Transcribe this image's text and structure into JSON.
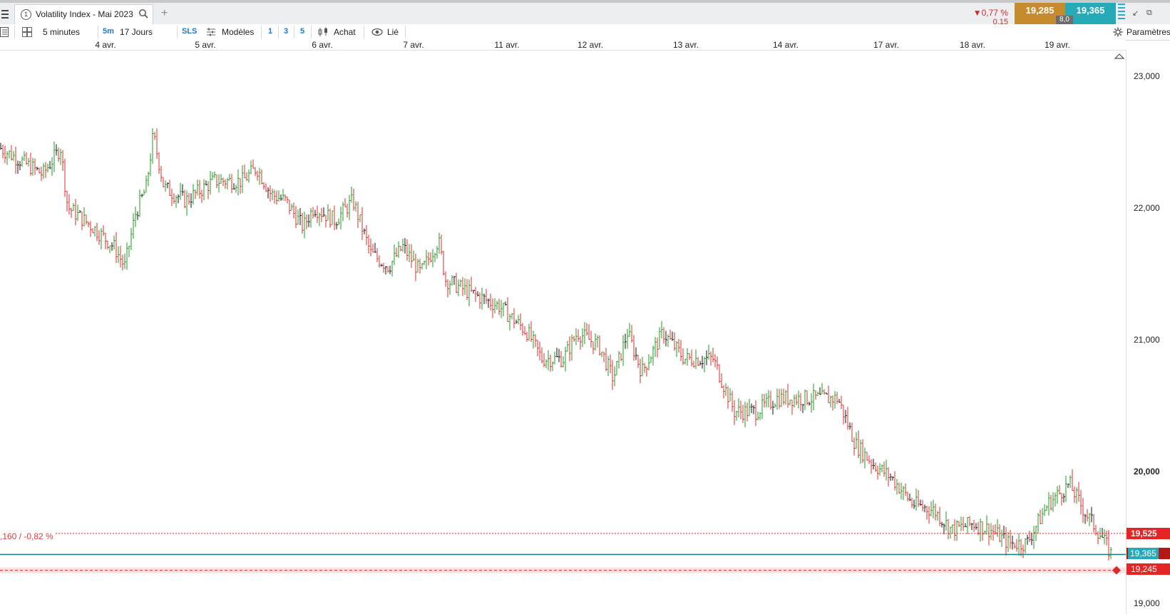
{
  "tab": {
    "number": "1",
    "title": "Volatility Index - Mai 2023",
    "add_label": "+"
  },
  "quote": {
    "change_pct": "▼0,77 %",
    "change_abs": "0,15",
    "bid": "19,285",
    "ask": "19,365",
    "spread": "8,0"
  },
  "toolbar": {
    "interval": "5 minutes",
    "interval_short": "5m",
    "range": "17 Jours",
    "sls": "SLS",
    "templates": "Modèles",
    "q1": "1",
    "q2": "3",
    "q3": "5",
    "buy": "Achat",
    "linked": "Lié",
    "settings": "Paramètres"
  },
  "date_axis": [
    "4 avr.",
    "5 avr.",
    "6 avr.",
    "7 avr.",
    "11 avr.",
    "12 avr.",
    "13 avr.",
    "14 avr.",
    "17 avr.",
    "18 avr.",
    "19 avr."
  ],
  "price_axis": [
    "23,000",
    "22,000",
    "21,000",
    "20,000",
    "19,000"
  ],
  "lines": {
    "reference_label": ",160 / -0,82 %",
    "reference_tag": "19,525",
    "current_tag": "19,365",
    "stop_tag": "19,245"
  },
  "colors": {
    "up": "#1f9a1f",
    "down": "#e02828",
    "neutral": "#111111",
    "reference": "#e02828",
    "current": "#1c7f8c",
    "stop_band": "#fde0e0",
    "bid_bg": "#c58b2c",
    "ask_bg": "#27aab7"
  },
  "chart_data": {
    "type": "line",
    "title": "",
    "x": [
      "4 avr.",
      "5 avr.",
      "6 avr.",
      "7 avr.",
      "11 avr.",
      "12 avr.",
      "13 avr.",
      "14 avr.",
      "17 avr.",
      "18 avr.",
      "19 avr."
    ],
    "ylim": [
      18.95,
      23.15
    ],
    "series": [
      {
        "values": [
          22.45,
          22.0,
          22.2,
          21.7,
          21.85,
          20.95,
          20.9,
          20.55,
          20.55,
          19.35,
          19.45
        ]
      }
    ]
  }
}
